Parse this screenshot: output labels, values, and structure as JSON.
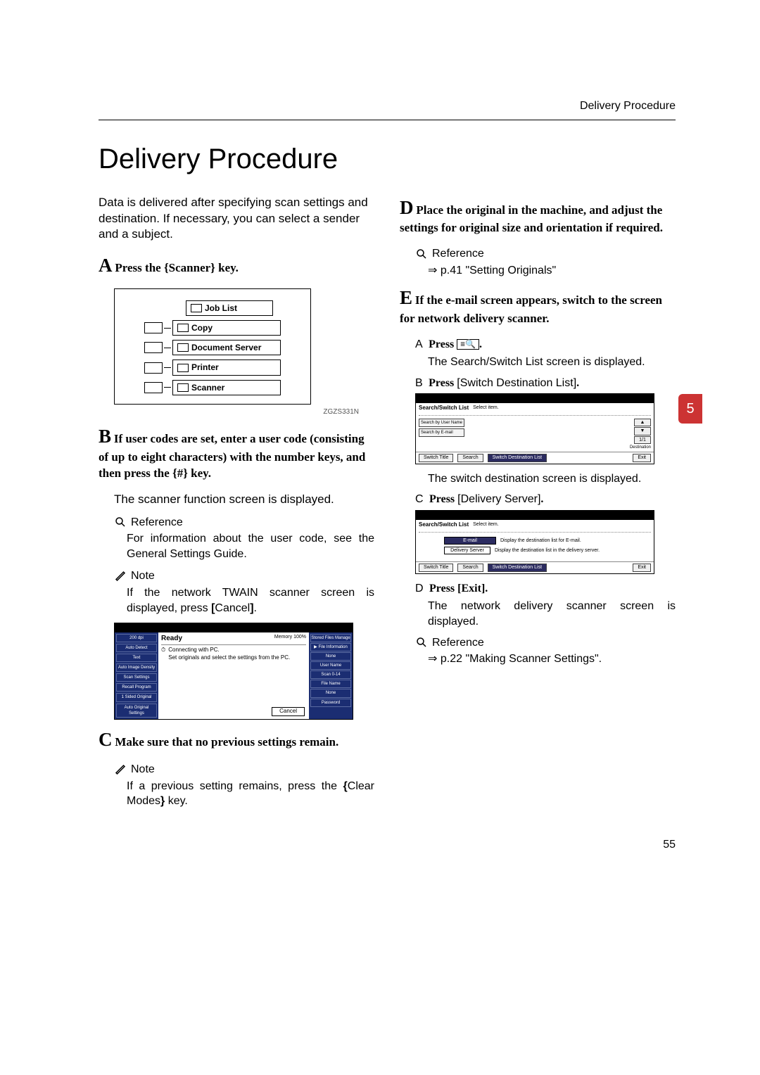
{
  "header": {
    "section": "Delivery Procedure"
  },
  "title": "Delivery Procedure",
  "intro": "Data is delivered after specifying scan settings and destination. If necessary, you can select a sender and a subject.",
  "sideTab": "5",
  "stepA": {
    "prefix": "Press the ",
    "key": "Scanner",
    "suffix": " key."
  },
  "panel": {
    "items": [
      "Job List",
      "Copy",
      "Document Server",
      "Printer",
      "Scanner"
    ],
    "caption": "ZGZS331N"
  },
  "stepB": {
    "text": "If user codes are set, enter a user code (consisting of up to eight characters) with the number keys, and then press the ",
    "key": "#",
    "suffix": " key.",
    "body": "The scanner function screen is displayed.",
    "refLabel": "Reference",
    "refBody": "For information about the user code, see the General Settings Guide.",
    "noteLabel": "Note",
    "noteBody1": "If the network TWAIN scanner screen is displayed, press ",
    "noteKey": "Cancel",
    "noteBody2": "."
  },
  "screenshot1": {
    "side": [
      "200 dpi",
      "Auto Detect",
      "Text",
      "Auto Image Density",
      "Scan Settings",
      "Recall Program",
      "1 Sided Original",
      "Auto Original Settings"
    ],
    "ready": "Ready",
    "memory": "Memory 100%",
    "msg1": "Connecting with PC.",
    "msg2": "Set originals and select the settings from the PC.",
    "right": [
      "Stored Files Manage",
      "▶ File Information",
      "None",
      "User Name",
      "Scan 0-14",
      "File Name",
      "None",
      "Password"
    ],
    "cancel": "Cancel"
  },
  "stepC": {
    "text": "Make sure that no previous settings remain.",
    "noteLabel": "Note",
    "noteBody1": "If a previous setting remains, press the ",
    "noteKey": "Clear Modes",
    "noteBody2": " key."
  },
  "stepD": {
    "text": "Place the original in the machine, and adjust the settings for original size and orientation if required.",
    "refLabel": "Reference",
    "refArrow": "⇒",
    "refBody": " p.41 \"Setting Originals\""
  },
  "stepE": {
    "text": "If the e-mail screen appears, switch to the screen for network delivery scanner.",
    "subA": {
      "label": "A",
      "bold": "Press ",
      "keyGlyph": "≡🔍",
      "after": ".",
      "body": "The Search/Switch List screen is displayed."
    },
    "subB": {
      "label": "B",
      "bold": "Press ",
      "key": "Switch Destination List",
      "after": "."
    },
    "screenshot2": {
      "title": "Search/Switch List",
      "select": "Select item.",
      "sidebtns": [
        "Search by User Name",
        "Search by E-mail"
      ],
      "pager": [
        "▲",
        "▼",
        "1/1"
      ],
      "right": "Destination",
      "bottom": [
        "Switch Title",
        "Search",
        "Switch Destination List"
      ],
      "exit": "Exit"
    },
    "bodyAfter2": "The switch destination screen is displayed.",
    "subC": {
      "label": "C",
      "bold": "Press ",
      "key": "Delivery Server",
      "after": "."
    },
    "screenshot3": {
      "title": "Search/Switch List",
      "select": "Select item.",
      "btnEmail": "E-mail",
      "emailDesc": "Display the destination list for E-mail.",
      "btnDelivery": "Delivery Server",
      "deliveryDesc": "Display the destination list in the delivery server.",
      "bottom": [
        "Switch Title",
        "Search",
        "Switch Destination List"
      ],
      "exit": "Exit"
    },
    "subD": {
      "label": "D",
      "bold": "Press ",
      "key": "Exit",
      "after": ".",
      "body": "The network delivery scanner screen is displayed."
    },
    "refLabel": "Reference",
    "refArrow": "⇒",
    "refBody": " p.22 \"Making Scanner Settings\"."
  },
  "pageNumber": "55"
}
